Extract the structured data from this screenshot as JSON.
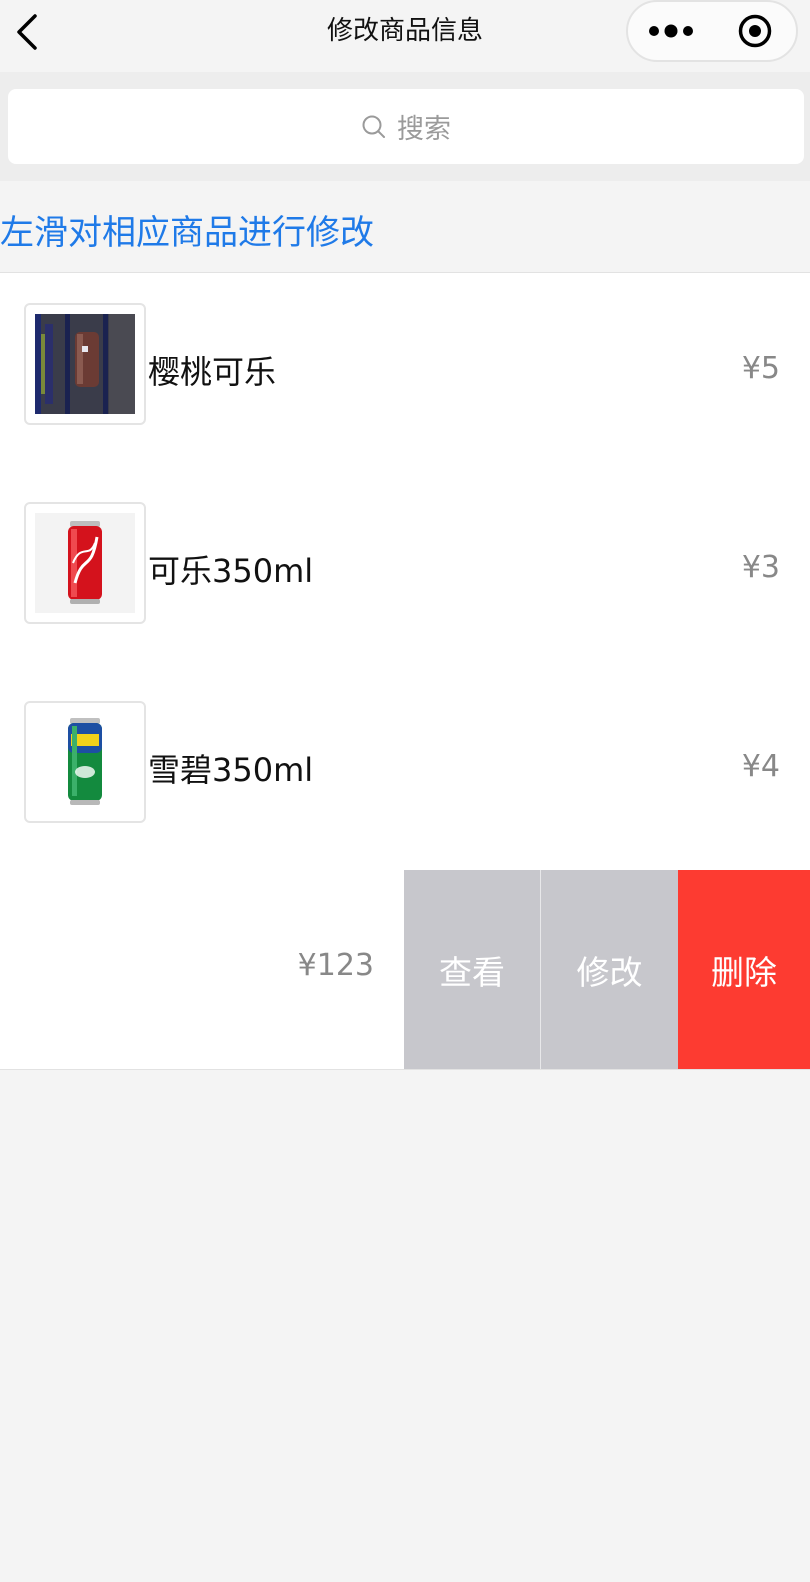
{
  "nav": {
    "title": "修改商品信息"
  },
  "search": {
    "placeholder": "搜索"
  },
  "hint": "左滑对相应商品进行修改",
  "products": [
    {
      "name": "樱桃可乐",
      "price": "¥5"
    },
    {
      "name": "可乐350ml",
      "price": "¥3"
    },
    {
      "name": "雪碧350ml",
      "price": "¥4"
    },
    {
      "name": "",
      "price": "¥123"
    }
  ],
  "actions": {
    "view": "查看",
    "edit": "修改",
    "delete": "删除"
  },
  "colors": {
    "hint_blue": "#1f7ae8",
    "action_gray": "#c7c7cc",
    "action_red": "#fd3b31"
  }
}
